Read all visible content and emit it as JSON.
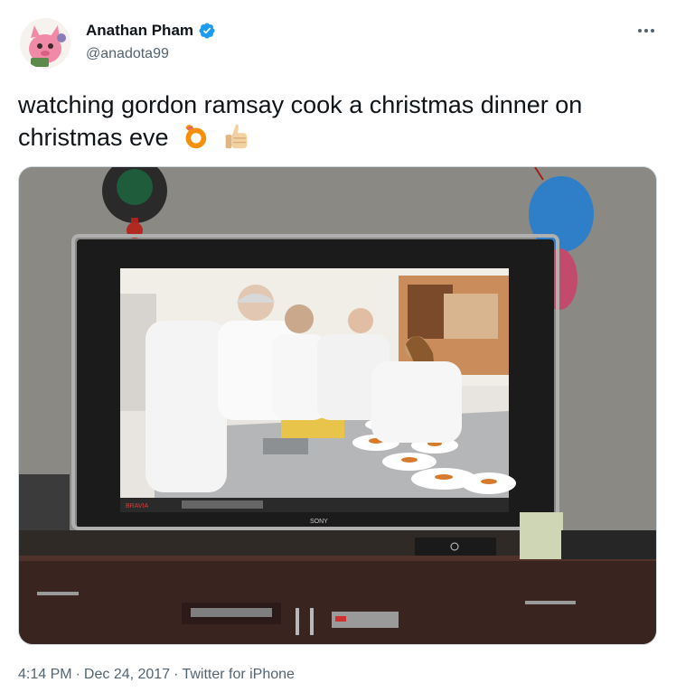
{
  "author": {
    "name": "Anathan Pham",
    "handle": "@anadota99",
    "verified": true,
    "verified_color": "#1d9bf0"
  },
  "tweet": {
    "text": "watching gordon ramsay cook a christmas dinner on christmas eve",
    "emojis": [
      "ok-hand-emoji",
      "thumbs-up-emoji"
    ]
  },
  "media": {
    "tv_brand": "SONY",
    "tv_corner_label": "BRAVIA"
  },
  "meta": {
    "time": "4:14 PM",
    "separator1": "·",
    "date": "Dec 24, 2017",
    "separator2": "·",
    "source": "Twitter for iPhone"
  }
}
